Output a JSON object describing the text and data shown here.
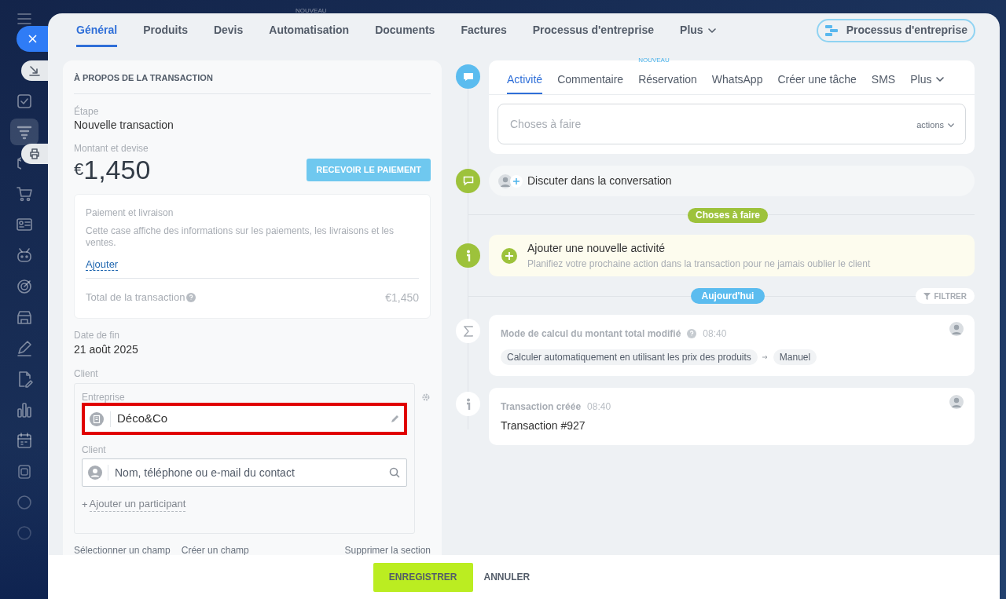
{
  "sidebar": {
    "items": [
      {
        "selected": false
      },
      {
        "selected": true
      },
      {
        "selected": false
      },
      {
        "selected": false
      },
      {
        "selected": false
      },
      {
        "selected": false
      },
      {
        "selected": false
      },
      {
        "selected": false
      },
      {
        "selected": false
      },
      {
        "selected": false
      },
      {
        "selected": false
      },
      {
        "selected": false
      },
      {
        "selected": false
      },
      {
        "selected": false
      },
      {
        "selected": false
      }
    ]
  },
  "top_badge": "NOUVEAU",
  "tabs": [
    {
      "label": "Général",
      "selected": true,
      "kind": "tab"
    },
    {
      "label": "Produits",
      "selected": false,
      "kind": "tab"
    },
    {
      "label": "Devis",
      "selected": false,
      "kind": "tab"
    },
    {
      "label": "Automatisation",
      "selected": false,
      "kind": "tab"
    },
    {
      "label": "Documents",
      "selected": false,
      "kind": "tab"
    },
    {
      "label": "Factures",
      "selected": false,
      "kind": "tab"
    },
    {
      "label": "Processus d'entreprise",
      "selected": false,
      "kind": "tab"
    },
    {
      "label": "Plus",
      "selected": false,
      "kind": "dropdown"
    }
  ],
  "process_button": "Processus d'entreprise",
  "about": {
    "title": "À PROPOS DE LA TRANSACTION",
    "stage_label": "Étape",
    "stage": "Nouvelle transaction",
    "amount_label": "Montant et devise",
    "currency": "€",
    "amount": "1,450",
    "pay_button": "RECEVOIR LE PAIEMENT",
    "payment_box": {
      "title": "Paiement et livraison",
      "description": "Cette case affiche des informations sur les paiements, les livraisons et les ventes.",
      "add_link": "Ajouter",
      "total_label": "Total de la transaction",
      "total": "€1,450"
    },
    "end_date_label": "Date de fin",
    "end_date": "21 août 2025",
    "client_label": "Client",
    "company_label": "Entreprise",
    "company": "Déco&Co",
    "company_highlighted": true,
    "contact_label": "Client",
    "contact_placeholder": "Nom, téléphone ou e-mail du contact",
    "add_participant_plus": "+",
    "add_participant": "Ajouter un participant",
    "footer_links": [
      "Sélectionner un champ",
      "Créer un champ",
      "Supprimer la section"
    ]
  },
  "activity": {
    "tabs": [
      {
        "label": "Activité",
        "selected": true,
        "kind": "tab"
      },
      {
        "label": "Commentaire",
        "selected": false,
        "kind": "tab"
      },
      {
        "label": "Réservation",
        "selected": false,
        "kind": "tab",
        "badge": "NOUVEAU"
      },
      {
        "label": "WhatsApp",
        "selected": false,
        "kind": "tab"
      },
      {
        "label": "Créer une tâche",
        "selected": false,
        "kind": "tab"
      },
      {
        "label": "SMS",
        "selected": false,
        "kind": "tab"
      },
      {
        "label": "Plus",
        "selected": false,
        "kind": "dropdown"
      }
    ],
    "input_placeholder": "Choses à faire",
    "actions": "actions",
    "chat": "Discuter dans la conversation",
    "todo_divider": "Choses à faire",
    "add_activity": {
      "title": "Ajouter une nouvelle activité",
      "subtitle": "Planifiez votre prochaine action dans la transaction pour ne jamais oublier le client"
    },
    "today_divider": "Aujourd'hui",
    "filter": "FILTRER",
    "events": [
      {
        "kind": "change",
        "title": "Mode de calcul du montant total modifié",
        "time": "08:40",
        "from": "Calculer automatiquement en utilisant les prix des produits",
        "to": "Manuel"
      },
      {
        "kind": "created",
        "title": "Transaction créée",
        "time": "08:40",
        "body": "Transaction #927"
      }
    ]
  },
  "footer": {
    "save": "ENREGISTRER",
    "cancel": "ANNULER"
  }
}
